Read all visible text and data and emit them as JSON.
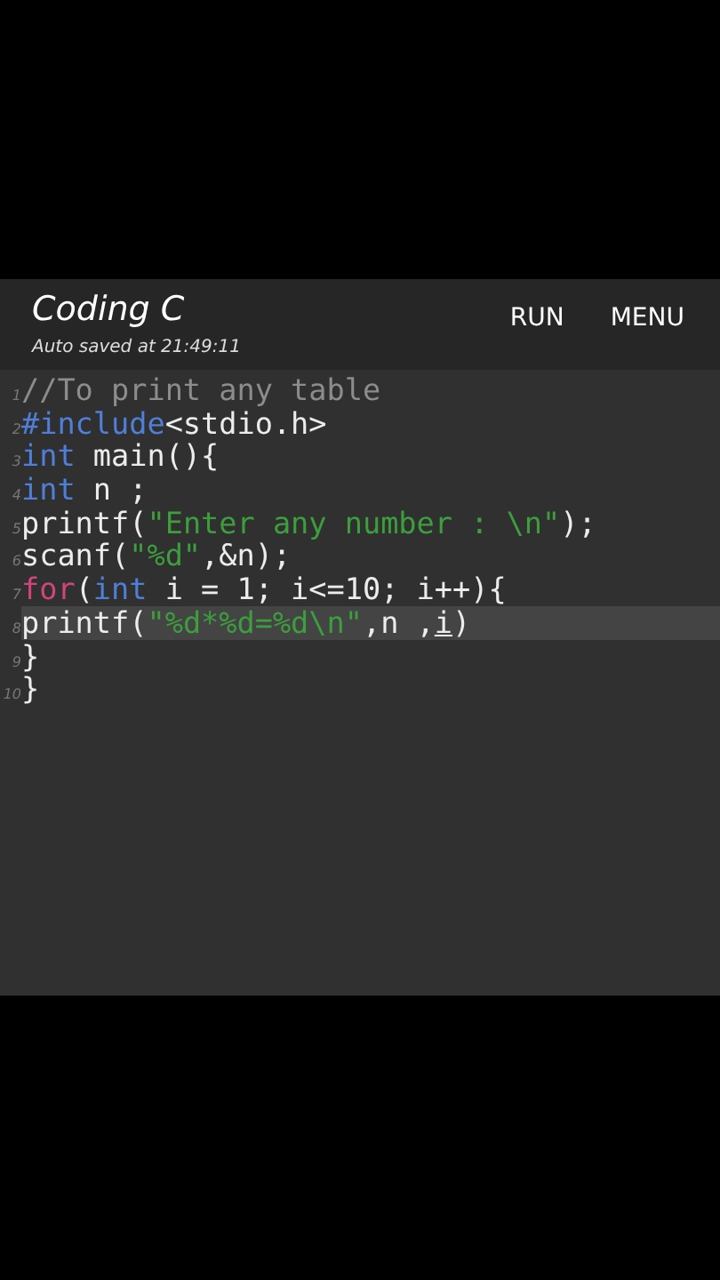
{
  "header": {
    "title": "Coding C",
    "subtitle": "Auto saved at 21:49:11",
    "actions": [
      "RUN",
      "MENU"
    ]
  },
  "editor": {
    "lines": [
      {
        "number": "1",
        "current": false,
        "tokens": [
          {
            "kind": "comment",
            "text": "//To print any table"
          }
        ]
      },
      {
        "number": "2",
        "current": false,
        "tokens": [
          {
            "kind": "keyword",
            "text": "#include"
          },
          {
            "kind": "plain",
            "text": "<stdio.h>"
          }
        ]
      },
      {
        "number": "3",
        "current": false,
        "tokens": [
          {
            "kind": "keyword",
            "text": "int"
          },
          {
            "kind": "plain",
            "text": " main(){"
          }
        ]
      },
      {
        "number": "4",
        "current": false,
        "tokens": [
          {
            "kind": "keyword",
            "text": "int"
          },
          {
            "kind": "plain",
            "text": " n ;"
          }
        ]
      },
      {
        "number": "5",
        "current": false,
        "tokens": [
          {
            "kind": "plain",
            "text": "printf("
          },
          {
            "kind": "string",
            "text": "\"Enter any number : \\n\""
          },
          {
            "kind": "plain",
            "text": ");"
          }
        ]
      },
      {
        "number": "6",
        "current": false,
        "tokens": [
          {
            "kind": "plain",
            "text": "scanf("
          },
          {
            "kind": "string",
            "text": "\"%d\""
          },
          {
            "kind": "plain",
            "text": ",&n);"
          }
        ]
      },
      {
        "number": "7",
        "current": false,
        "tokens": [
          {
            "kind": "control",
            "text": "for"
          },
          {
            "kind": "plain",
            "text": "("
          },
          {
            "kind": "keyword",
            "text": "int"
          },
          {
            "kind": "plain",
            "text": " i = 1; i<=10; i++){"
          }
        ]
      },
      {
        "number": "8",
        "current": true,
        "tokens": [
          {
            "kind": "plain",
            "text": "printf("
          },
          {
            "kind": "string",
            "text": "\"%d*%d=%d\\n\""
          },
          {
            "kind": "plain",
            "text": ",n ,"
          },
          {
            "kind": "underlined",
            "text": "i"
          },
          {
            "kind": "plain",
            "text": ")"
          }
        ]
      },
      {
        "number": "9",
        "current": false,
        "tokens": [
          {
            "kind": "plain",
            "text": "}"
          }
        ]
      },
      {
        "number": "10",
        "current": false,
        "tokens": [
          {
            "kind": "plain",
            "text": "}"
          }
        ]
      }
    ]
  }
}
